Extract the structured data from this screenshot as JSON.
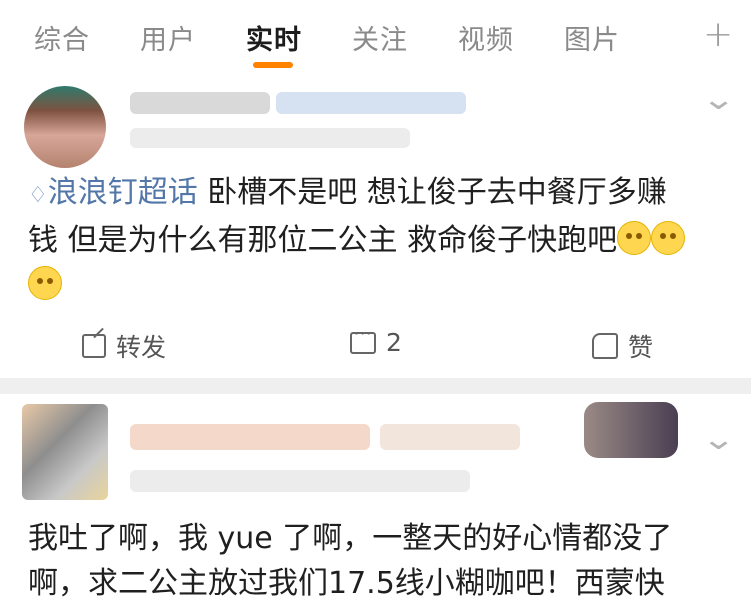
{
  "tabs": [
    "综合",
    "用户",
    "实时",
    "关注",
    "视频",
    "图片"
  ],
  "active_tab": "实时",
  "add_icon": "plus-icon",
  "post1": {
    "topic_icon": "diamond-topic-icon",
    "topic": "浪浪钉超话",
    "text_line1": " 卧槽不是吧 想让俊子去中餐厅多赚",
    "text_line2": "钱 但是为什么有那位二公主 救命俊子快跑吧",
    "emoji_name": "smile-emoji",
    "actions": {
      "share": "转发",
      "comment": "2",
      "like": "赞"
    }
  },
  "post2": {
    "text_line1": "我吐了啊，我 yue 了啊，一整天的好心情都没了",
    "text_line2": "啊，求二公主放过我们17.5线小糊咖吧！西蒙快"
  },
  "colors": {
    "accent": "#ff8200",
    "topic": "#5277a8",
    "separator": "#efefef"
  }
}
